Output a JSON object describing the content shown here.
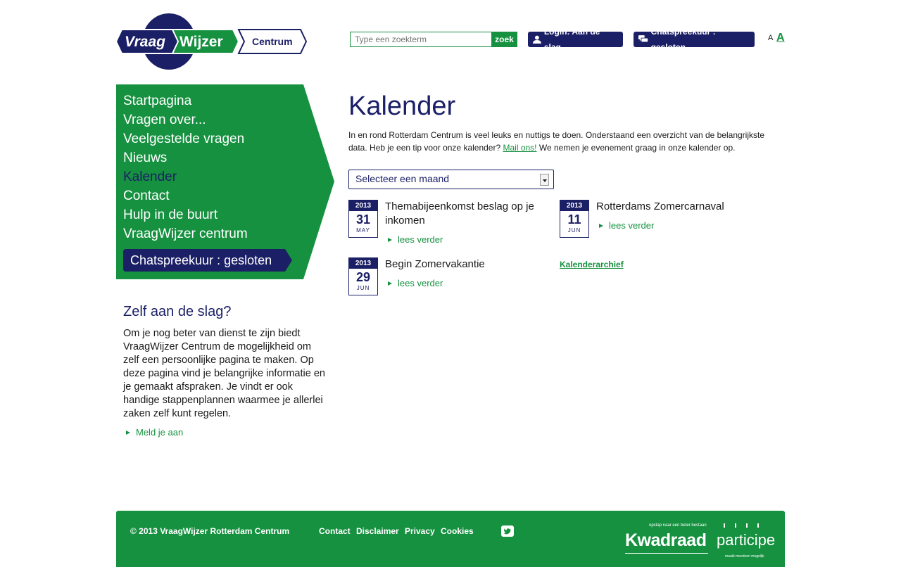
{
  "logo": {
    "part1": "Vraag",
    "part2": "Wijzer",
    "part3": "Centrum"
  },
  "header": {
    "search_placeholder": "Type een zoekterm",
    "search_button": "zoek",
    "login_label": "Login: Aan de slag",
    "chat_label": "Chatspreekuur : gesloten",
    "font_small": "A",
    "font_big": "A"
  },
  "nav": {
    "items": [
      {
        "label": "Startpagina"
      },
      {
        "label": "Vragen over..."
      },
      {
        "label": "Veelgestelde vragen"
      },
      {
        "label": "Nieuws"
      },
      {
        "label": "Kalender"
      },
      {
        "label": "Contact"
      },
      {
        "label": "Hulp in de buurt"
      },
      {
        "label": "VraagWijzer centrum"
      }
    ],
    "chat": "Chatspreekuur : gesloten"
  },
  "sidebar": {
    "title": "Zelf aan de slag?",
    "text": "Om je nog beter van dienst te zijn biedt VraagWijzer Centrum de mogelijkheid om zelf een persoonlijke pagina te maken. Op deze pagina vind je belangrijke informatie en je gemaakt afspraken. Je vindt er ook handige stappenplannen waarmee je allerlei zaken zelf kunt regelen.",
    "link": "Meld je aan"
  },
  "main": {
    "title": "Kalender",
    "intro_before": "In en rond Rotterdam Centrum is veel leuks en nuttigs te doen. Onderstaand een overzicht van de belangrijkste data. Heb je een tip voor onze kalender? ",
    "intro_link": "Mail ons!",
    "intro_after": " We nemen je evenement graag in onze kalender op.",
    "select_label": "Selecteer een maand",
    "read_more": "lees verder",
    "events": [
      {
        "year": "2013",
        "day": "31",
        "month": "MAY",
        "title": "Themabijeenkomst beslag op je inkomen"
      },
      {
        "year": "2013",
        "day": "11",
        "month": "JUN",
        "title": "Rotterdams Zomercarnaval"
      },
      {
        "year": "2013",
        "day": "29",
        "month": "JUN",
        "title": "Begin Zomervakantie"
      }
    ],
    "archive": "Kalenderarchief"
  },
  "footer": {
    "copyright": "© 2013 VraagWijzer Rotterdam Centrum",
    "links": [
      "Contact",
      "Disclaimer",
      "Privacy",
      "Cookies"
    ],
    "kwadraad_tag": "opstap naar een beter bestaan",
    "kwadraad_name": "Kwadraad",
    "participe_name": "participe",
    "participe_tag": "maakt meedoen mogelijk"
  },
  "colors": {
    "green": "#169140",
    "navy": "#1b1f66"
  }
}
